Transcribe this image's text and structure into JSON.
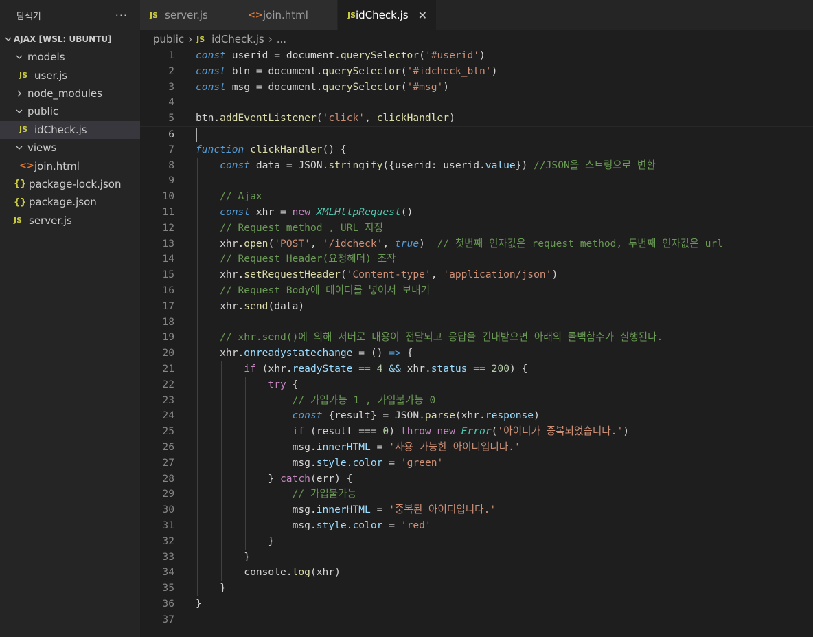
{
  "sidebar": {
    "title": "탐색기",
    "more": "···",
    "workspace": "AJAX [WSL: UBUNTU]",
    "tree": [
      {
        "label": "models",
        "type": "folder",
        "open": true,
        "depth": 1
      },
      {
        "label": "user.js",
        "type": "js",
        "depth": 2
      },
      {
        "label": "node_modules",
        "type": "folder",
        "open": false,
        "depth": 1
      },
      {
        "label": "public",
        "type": "folder",
        "open": true,
        "depth": 1
      },
      {
        "label": "idCheck.js",
        "type": "js",
        "depth": 2,
        "selected": true
      },
      {
        "label": "views",
        "type": "folder",
        "open": true,
        "depth": 1
      },
      {
        "label": "join.html",
        "type": "html",
        "depth": 2
      },
      {
        "label": "package-lock.json",
        "type": "json",
        "depth": 1
      },
      {
        "label": "package.json",
        "type": "json",
        "depth": 1
      },
      {
        "label": "server.js",
        "type": "js",
        "depth": 1
      }
    ]
  },
  "tabs": [
    {
      "label": "server.js",
      "type": "js",
      "active": false
    },
    {
      "label": "join.html",
      "type": "html",
      "active": false
    },
    {
      "label": "idCheck.js",
      "type": "js",
      "active": true
    }
  ],
  "icons": {
    "js": "JS",
    "html": "<>",
    "json": "{}",
    "close": "✕"
  },
  "breadcrumb": {
    "folder": "public",
    "file": "idCheck.js",
    "rest": "..."
  },
  "editor": {
    "current_line": 6,
    "lines": [
      "const userid = document.querySelector('#userid')",
      "const btn = document.querySelector('#idcheck_btn')",
      "const msg = document.querySelector('#msg')",
      "",
      "btn.addEventListener('click', clickHandler)",
      "",
      "function clickHandler() {",
      "    const data = JSON.stringify({userid: userid.value}) //JSON을 스트링으로 변환",
      "",
      "    // Ajax",
      "    const xhr = new XMLHttpRequest()",
      "    // Request method , URL 지정",
      "    xhr.open('POST', '/idcheck', true)  // 첫번째 인자값은 request method, 두번째 인자값은 url",
      "    // Request Header(요청헤더) 조작",
      "    xhr.setRequestHeader('Content-type', 'application/json')",
      "    // Request Body에 데이터를 넣어서 보내기",
      "    xhr.send(data)",
      "",
      "    // xhr.send()에 의해 서버로 내용이 전달되고 응답을 건내받으면 아래의 콜백함수가 실행된다.",
      "    xhr.onreadystatechange = () => {",
      "        if (xhr.readyState == 4 && xhr.status == 200) {",
      "            try {",
      "                // 가입가능 1 , 가입불가능 0",
      "                const {result} = JSON.parse(xhr.response)",
      "                if (result === 0) throw new Error('아이디가 중복되었습니다.')",
      "                msg.innerHTML = '사용 가능한 아이디입니다.'",
      "                msg.style.color = 'green'",
      "            } catch(err) {",
      "                // 가입불가능",
      "                msg.innerHTML = '중복된 아이디입니다.'",
      "                msg.style.color = 'red'",
      "            }",
      "        }",
      "        console.log(xhr)",
      "    }",
      "}",
      ""
    ]
  }
}
